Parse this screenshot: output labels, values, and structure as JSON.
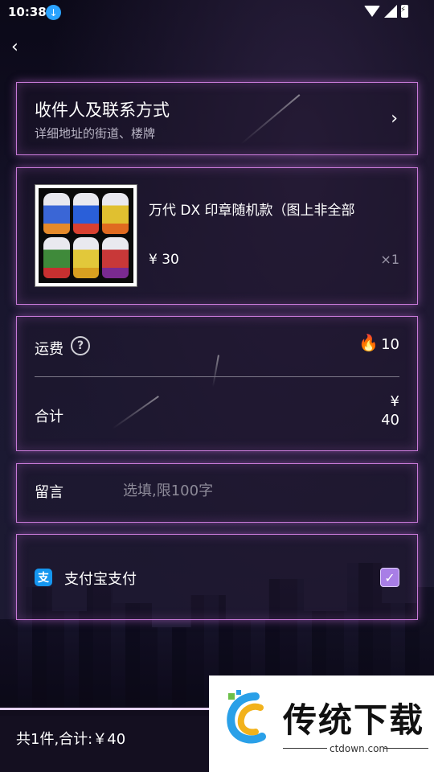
{
  "status_bar": {
    "time": "10:38"
  },
  "address": {
    "title": "收件人及联系方式",
    "subtitle": "详细地址的街道、楼牌"
  },
  "product": {
    "title": "万代 DX 印章随机款（图上非全部",
    "price": "¥ 30",
    "quantity": "×1"
  },
  "summary": {
    "shipping_label": "运费",
    "shipping_value": "10",
    "total_label": "合计",
    "total_value_currency": "¥",
    "total_value_amount": "40"
  },
  "memo": {
    "label": "留言",
    "placeholder": "选填,限100字"
  },
  "payment": {
    "label": "支付宝支付",
    "checked": true,
    "alipay_glyph": "支"
  },
  "bottom_bar": {
    "summary_text": "共1件,合计:￥40"
  },
  "watermark": {
    "title": "传统下载",
    "site": "ctdown.com"
  },
  "colors": {
    "card_border": "#c87ad8",
    "checkbox": "#a87ee6",
    "alipay_blue": "#1596f0"
  }
}
